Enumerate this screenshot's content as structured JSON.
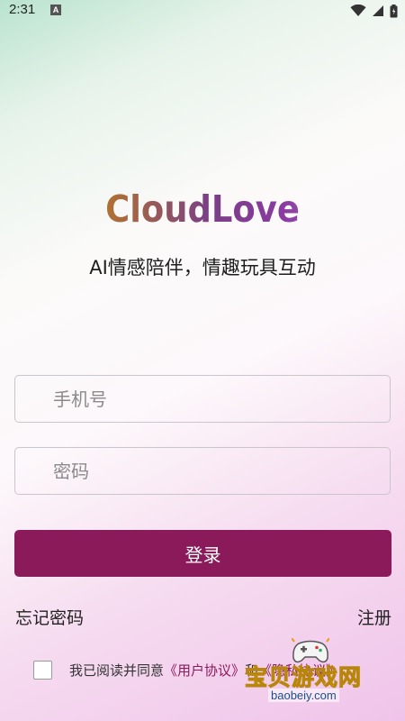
{
  "status_bar": {
    "time": "2:31",
    "notification_badge": "A",
    "icons": [
      "wifi-icon",
      "signal-icon",
      "battery-icon"
    ]
  },
  "brand": {
    "logo_text": "CloudLove",
    "tagline": "AI情感陪伴，情趣玩具互动",
    "accent_color": "#8b1a5a"
  },
  "form": {
    "phone_placeholder": "手机号",
    "phone_value": "",
    "password_placeholder": "密码",
    "password_value": "",
    "login_label": "登录"
  },
  "links": {
    "forgot_password": "忘记密码",
    "register": "注册"
  },
  "agreement": {
    "checked": false,
    "prefix": "我已阅读并同意",
    "user_agreement": "《用户协议》",
    "and": "和",
    "privacy_policy": "《隐私协议》"
  },
  "watermark": {
    "title": "宝贝游戏网",
    "url": "baobeiy.com"
  }
}
